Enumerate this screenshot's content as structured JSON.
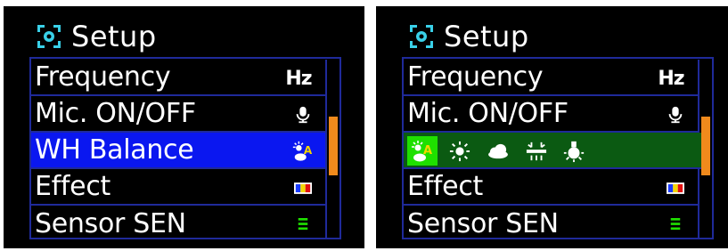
{
  "left": {
    "title": "Setup",
    "items": [
      {
        "label": "Frequency",
        "icon_text": "Hz",
        "icon": "hz-icon"
      },
      {
        "label": "Mic. ON/OFF",
        "icon": "microphone-icon"
      },
      {
        "label": "WH Balance",
        "icon": "auto-white-balance-icon",
        "selected": true
      },
      {
        "label": "Effect",
        "icon": "color-effect-icon"
      },
      {
        "label": "Sensor SEN",
        "icon": "sensor-level-icon"
      }
    ]
  },
  "right": {
    "title": "Setup",
    "items": [
      {
        "label": "Frequency",
        "icon_text": "Hz",
        "icon": "hz-icon"
      },
      {
        "label": "Mic. ON/OFF",
        "icon": "microphone-icon"
      },
      {
        "label": "Effect",
        "icon": "color-effect-icon"
      },
      {
        "label": "Sensor SEN",
        "icon": "sensor-level-icon"
      }
    ],
    "white_balance_options": [
      "auto-white-balance-icon",
      "sunny-icon",
      "cloudy-icon",
      "fluorescent-icon",
      "incandescent-icon"
    ],
    "white_balance_selected": "auto-white-balance-icon"
  },
  "colors": {
    "background": "#000000",
    "frame_border": "#1f2a9a",
    "selection": "#0a17f0",
    "submenu_bar": "#0b5a12",
    "submenu_active": "#1fe000",
    "scrollbar": "#f08a1c",
    "setup_icon": "#39d0e8"
  }
}
